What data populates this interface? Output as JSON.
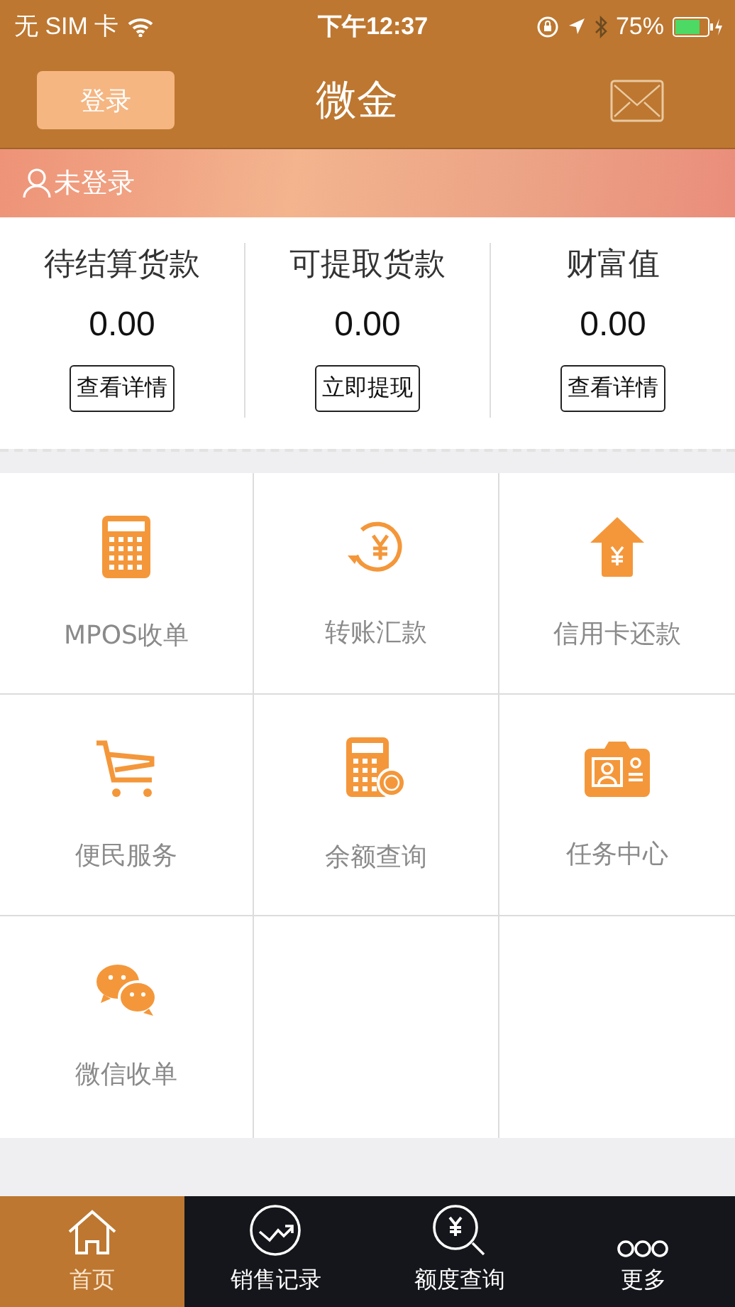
{
  "status_bar": {
    "carrier": "无 SIM 卡",
    "time": "下午12:37",
    "battery": "75%"
  },
  "header": {
    "login_button": "登录",
    "title": "微金"
  },
  "user_banner": {
    "label": "未登录"
  },
  "summary": [
    {
      "label": "待结算货款",
      "value": "0.00",
      "button": "查看详情"
    },
    {
      "label": "可提取货款",
      "value": "0.00",
      "button": "立即提现"
    },
    {
      "label": "财富值",
      "value": "0.00",
      "button": "查看详情"
    }
  ],
  "services": [
    {
      "kind": "calculator",
      "label": "MPOS收单"
    },
    {
      "kind": "transfer",
      "label": "转账汇款"
    },
    {
      "kind": "repay",
      "label": "信用卡还款"
    },
    {
      "kind": "cart",
      "label": "便民服务"
    },
    {
      "kind": "balance",
      "label": "余额查询"
    },
    {
      "kind": "task",
      "label": "任务中心"
    },
    {
      "kind": "chat",
      "label": "微信收单"
    }
  ],
  "tab_bar": [
    {
      "kind": "home",
      "label": "首页",
      "selected": true
    },
    {
      "kind": "sales",
      "label": "销售记录",
      "selected": false
    },
    {
      "kind": "quota",
      "label": "额度查询",
      "selected": false
    },
    {
      "kind": "more",
      "label": "更多",
      "selected": false
    }
  ]
}
